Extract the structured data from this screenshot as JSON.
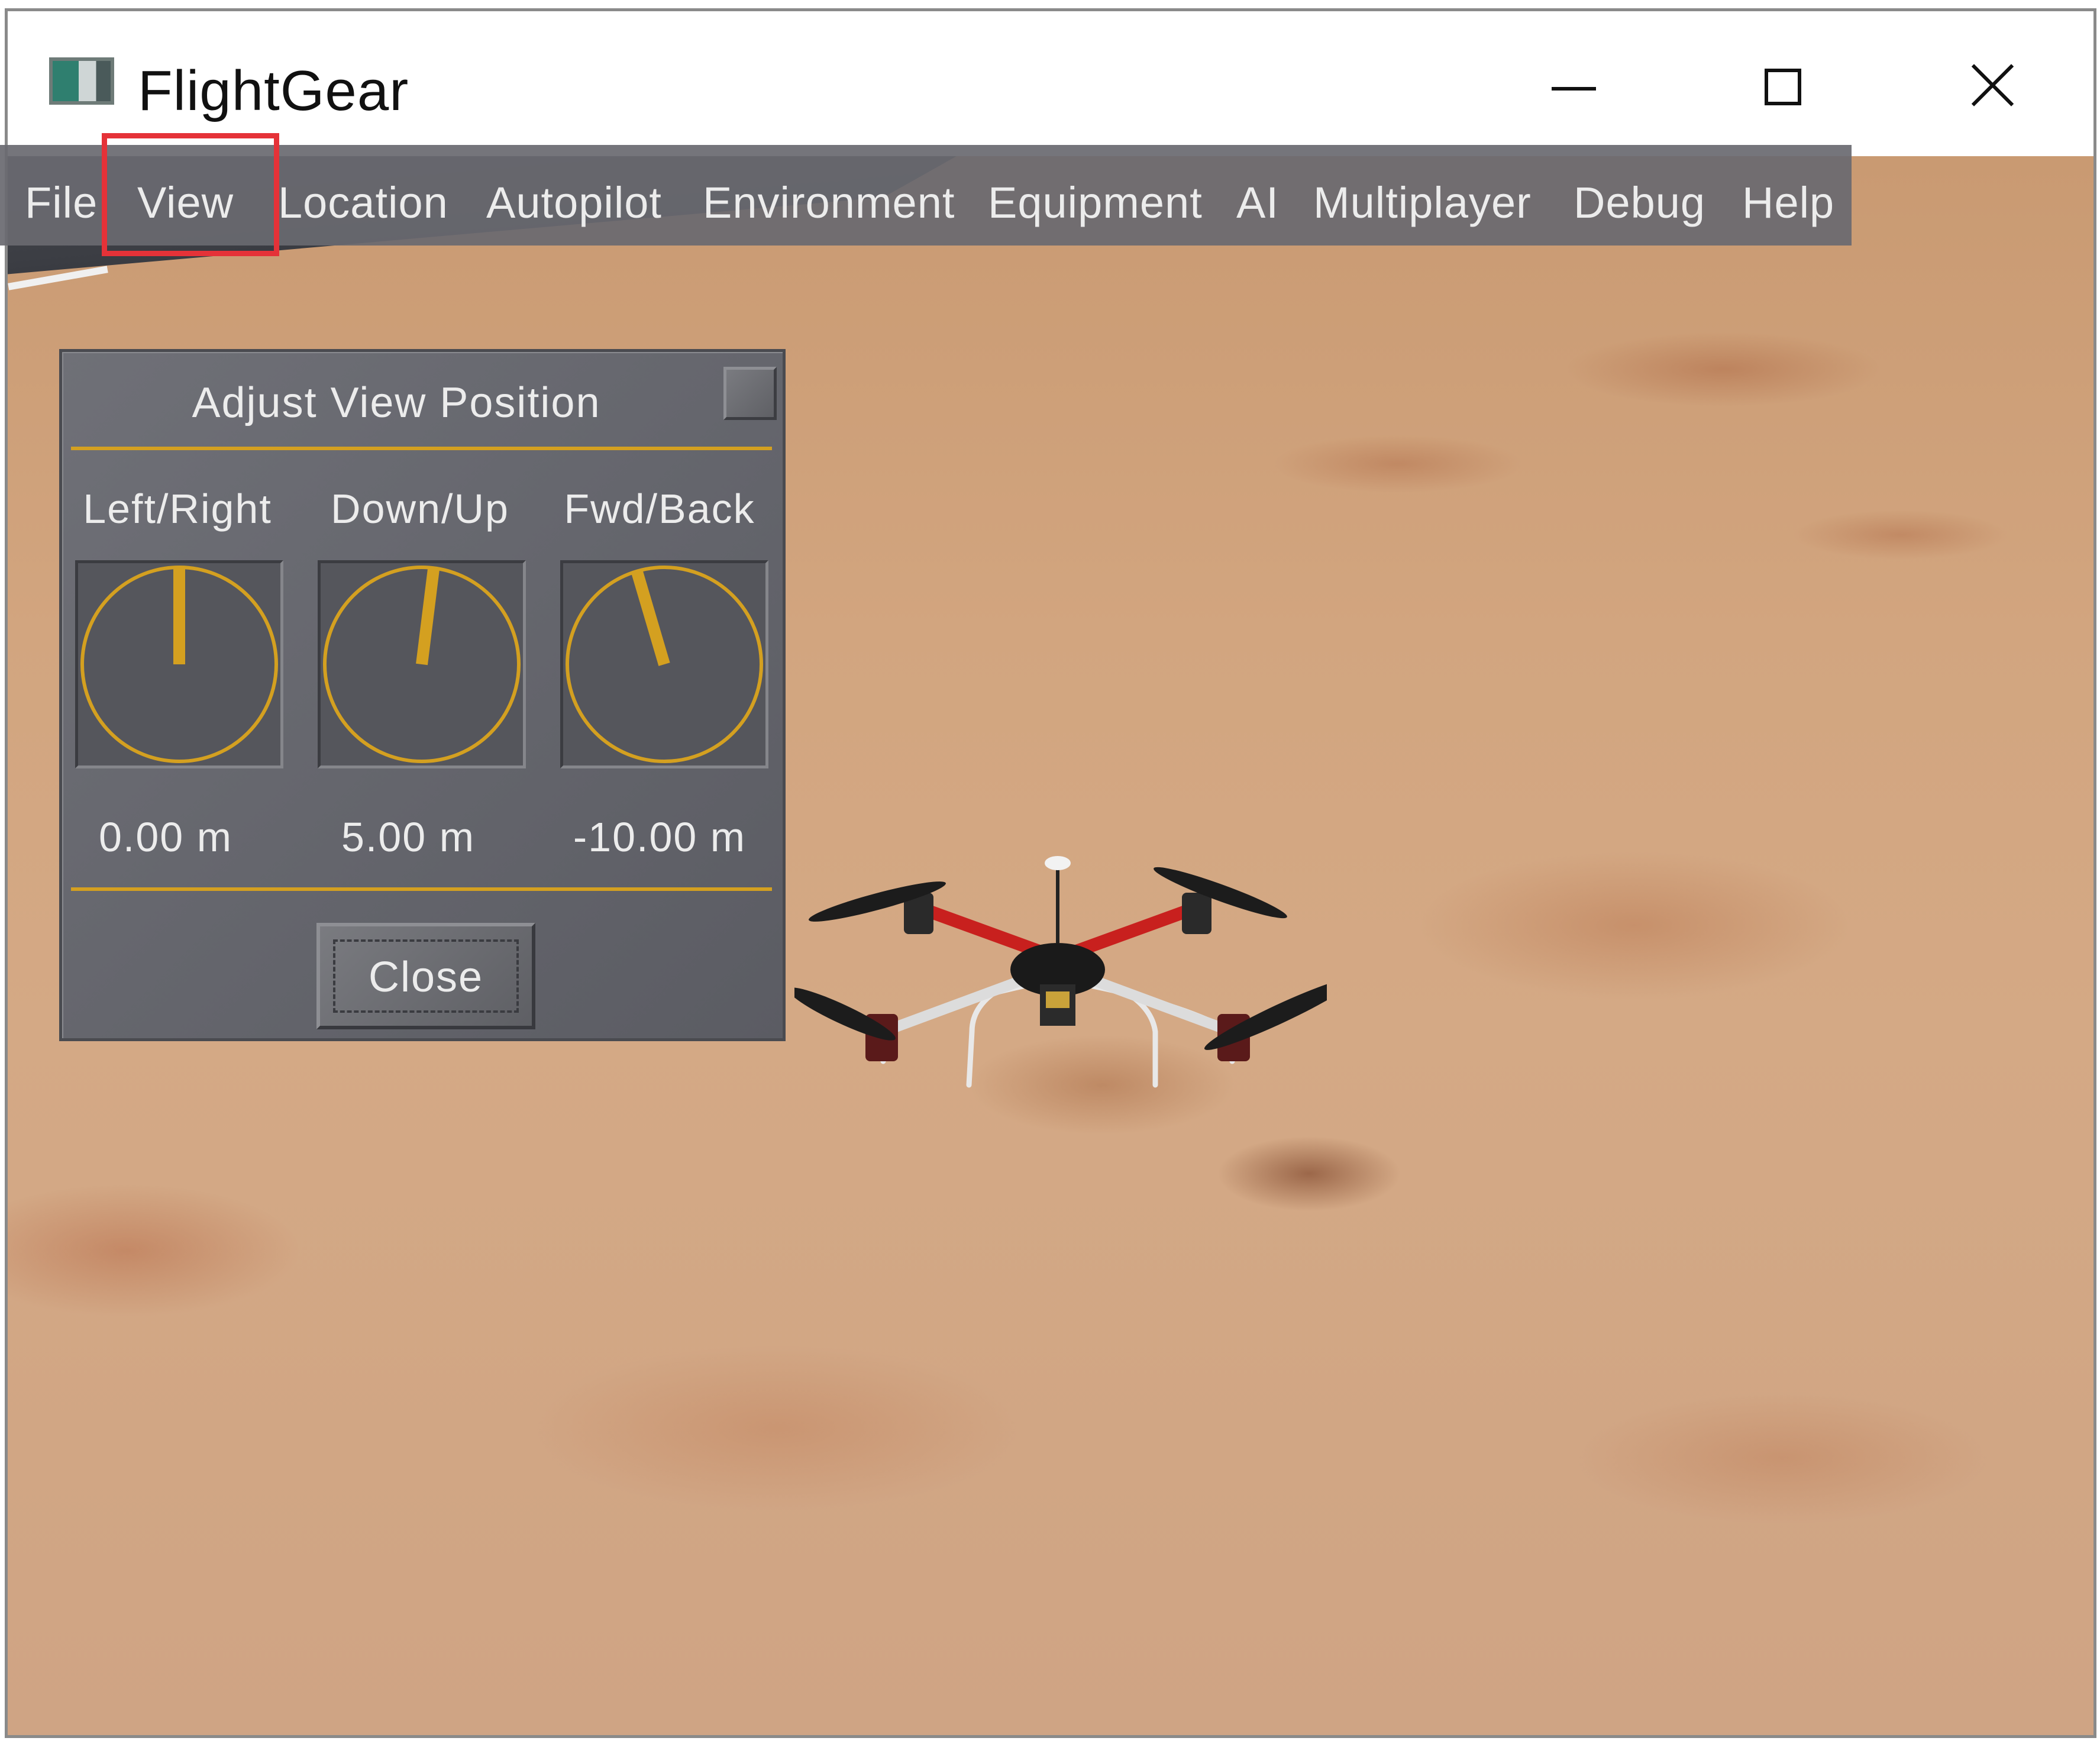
{
  "window": {
    "title": "FlightGear",
    "controls": [
      "minimize-icon",
      "maximize-icon",
      "close-icon"
    ]
  },
  "menubar": {
    "items": [
      "File",
      "View",
      "Location",
      "Autopilot",
      "Environment",
      "Equipment",
      "AI",
      "Multiplayer",
      "Debug",
      "Help"
    ],
    "highlighted": "View",
    "highlight_color": "#e53238"
  },
  "dialog": {
    "title": "Adjust View Position",
    "knobs": [
      {
        "label": "Left/Right",
        "value": "0.00 m"
      },
      {
        "label": "Down/Up",
        "value": "5.00 m"
      },
      {
        "label": "Fwd/Back",
        "value": "-10.00 m"
      }
    ],
    "close_label": "Close",
    "accent_color": "#d4a020"
  }
}
